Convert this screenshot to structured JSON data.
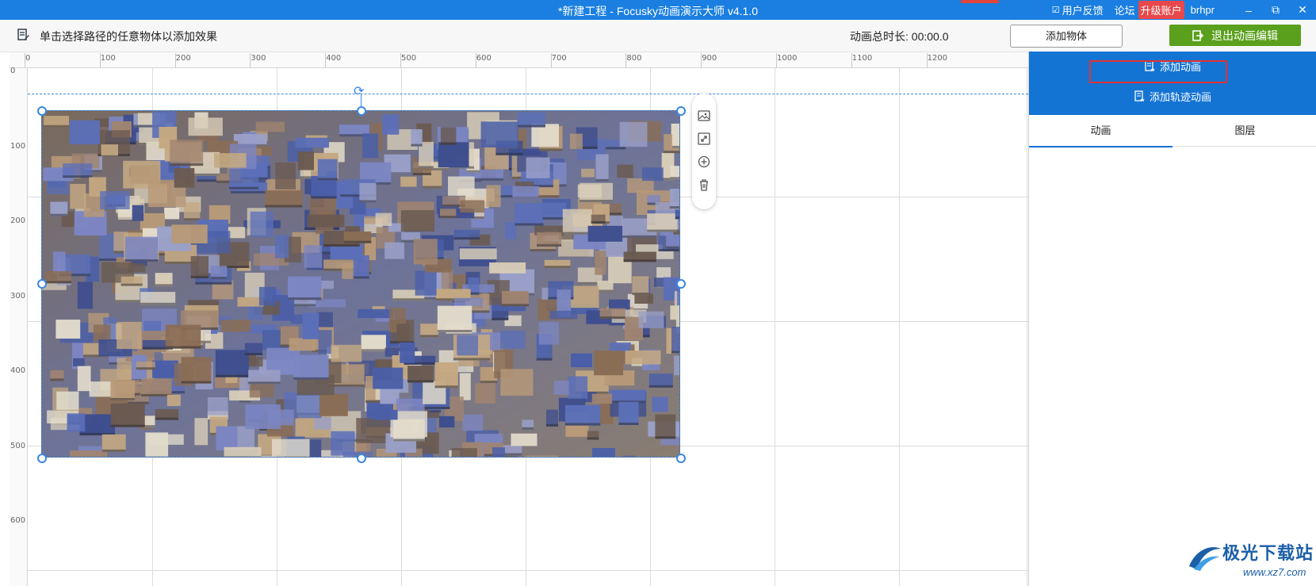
{
  "titlebar": {
    "title": "*新建工程 - Focusky动画演示大师  v4.1.0",
    "feedback": "用户反馈",
    "forum": "论坛",
    "upgrade": "升级账户",
    "username": "brhpr",
    "minimize": "–",
    "restore": "⧉",
    "close": "✕"
  },
  "toolbar": {
    "hint": "单击选择路径的任意物体以添加效果",
    "duration": "动画总时长: 00:00.0",
    "add_object": "添加物体",
    "exit_edit": "退出动画编辑"
  },
  "ruler": {
    "top": [
      "0",
      "100",
      "200",
      "300",
      "400",
      "500",
      "600",
      "700",
      "800",
      "900",
      "1000",
      "1100",
      "1200"
    ],
    "left": [
      "0",
      "100",
      "200",
      "300",
      "400",
      "500",
      "600"
    ]
  },
  "panel": {
    "add_animation": "添加动画",
    "add_path_animation": "添加轨迹动画",
    "tabs": [
      "动画",
      "图层"
    ]
  },
  "watermark": {
    "text": "极光下载站",
    "url": "www.xz7.com"
  },
  "colors": {
    "titlebar": "#1a7fe0",
    "accent": "#1474d4",
    "exit_green": "#5aa01c",
    "upgrade_red": "#e8484b",
    "selection": "#3a87e0",
    "highlight_red": "#e03333"
  }
}
